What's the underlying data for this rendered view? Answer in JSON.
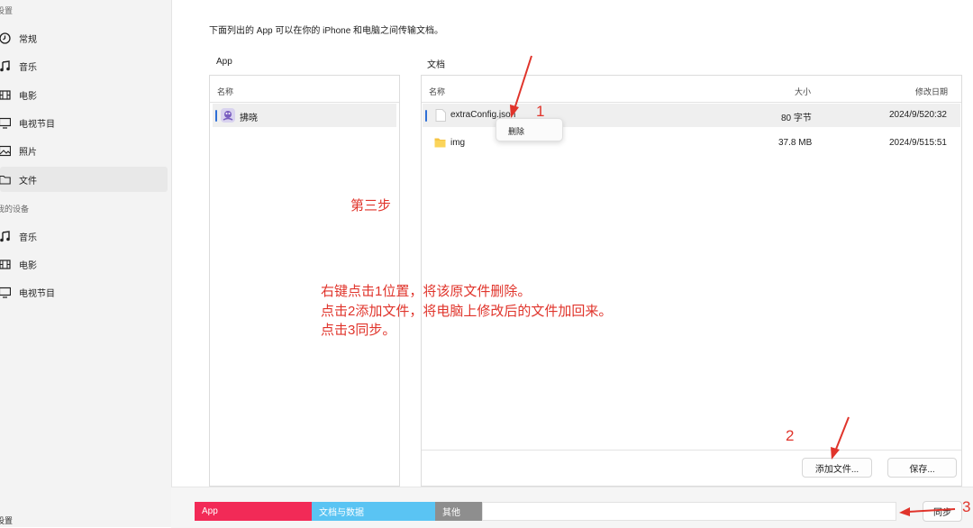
{
  "sidebar": {
    "section_settings": "设置",
    "items_top": [
      {
        "label": "常规",
        "icon": "clock-icon"
      },
      {
        "label": "音乐",
        "icon": "music-note-icon"
      },
      {
        "label": "电影",
        "icon": "film-icon"
      },
      {
        "label": "电视节目",
        "icon": "tv-icon"
      },
      {
        "label": "照片",
        "icon": "photo-icon"
      },
      {
        "label": "文件",
        "icon": "folder-icon"
      }
    ],
    "section_device": "我的设备",
    "items_device": [
      {
        "label": "音乐",
        "icon": "music-note-icon"
      },
      {
        "label": "电影",
        "icon": "film-icon"
      },
      {
        "label": "电视节目",
        "icon": "tv-icon"
      }
    ],
    "footer_settings": "设置"
  },
  "main": {
    "intro": "下面列出的 App 可以在你的 iPhone 和电脑之间传输文档。",
    "app_panel": {
      "title": "App",
      "header_name": "名称",
      "items": [
        {
          "name": "拂晓"
        }
      ]
    },
    "docs_panel": {
      "title": "文档",
      "col_name": "名称",
      "col_size": "大小",
      "col_date": "修改日期",
      "rows": [
        {
          "name": "extraConfig.json",
          "size": "80 字节",
          "date": "2024/9/520:32"
        },
        {
          "name": "img",
          "size": "37.8 MB",
          "date": "2024/9/515:51"
        }
      ]
    },
    "context_menu": {
      "delete": "删除"
    },
    "buttons": {
      "add_file": "添加文件...",
      "save": "保存...",
      "sync": "同步"
    }
  },
  "storage": [
    {
      "label": "App",
      "color": "#f22a57"
    },
    {
      "label": "文档与数据",
      "color": "#5ac4f3"
    },
    {
      "label": "其他",
      "color": "#8e8e8e"
    }
  ],
  "annotations": {
    "step": "第三步",
    "instr1": "右键点击1位置，将该原文件删除。",
    "instr2": "点击2添加文件，将电脑上修改后的文件加回来。",
    "instr3": "点击3同步。",
    "n1": "1",
    "n2": "2",
    "n3": "3"
  },
  "colors": {
    "accent": "#2f6fd6",
    "annotation": "#e0342b"
  }
}
